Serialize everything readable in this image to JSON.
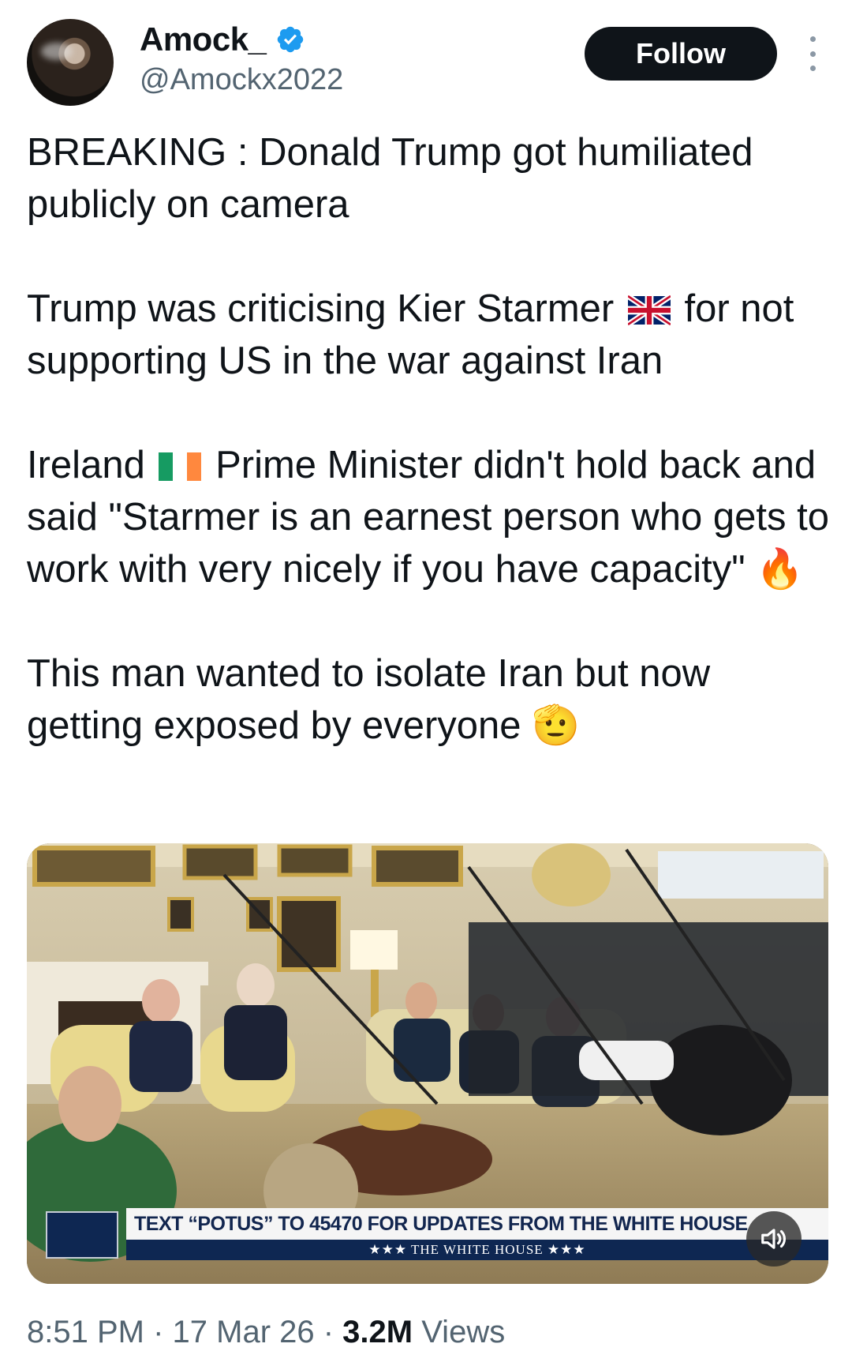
{
  "author": {
    "display_name": "Amock_",
    "handle": "@Amockx2022",
    "verified": true
  },
  "actions": {
    "follow_label": "Follow"
  },
  "tweet": {
    "p1": "BREAKING : Donald Trump got humiliated publicly on camera",
    "p2a": "Trump was criticising Kier Starmer",
    "p2b": " for not supporting US in the war against Iran",
    "p3a": "Ireland",
    "p3b": " Prime Minister didn't hold back and said \"Starmer is an earnest person who gets to work with very nicely if you have capacity\" ",
    "p3_emoji": "🔥",
    "p4a": "This man wanted to isolate Iran but now getting exposed by everyone ",
    "p4_emoji": "🫡"
  },
  "media": {
    "banner_text": "TEXT “POTUS” TO 45470 FOR UPDATES FROM THE WHITE HOUSE",
    "banner_sub": "★★★  THE WHITE HOUSE  ★★★",
    "mute_icon": "speaker-icon"
  },
  "meta": {
    "time": "8:51 PM",
    "sep1": " · ",
    "date": "17 Mar 26",
    "sep2": " · ",
    "views_count": "3.2M",
    "views_label": " Views"
  },
  "colors": {
    "follow_bg": "#0f1419",
    "verified_blue": "#1d9bf0",
    "secondary_text": "#536471",
    "banner_navy": "#0e2752"
  }
}
